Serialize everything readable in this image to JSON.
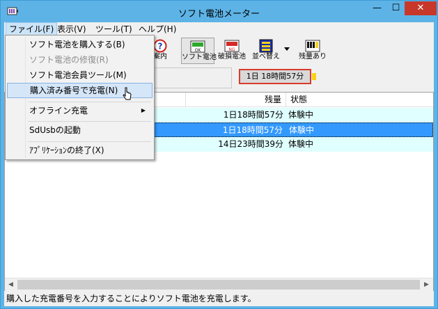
{
  "window": {
    "title": "ソフト電池メーター",
    "minimize": "—",
    "maximize": "☐",
    "close": "✕"
  },
  "menubar": [
    {
      "label": "ファイル(F)"
    },
    {
      "label": "表示(V)"
    },
    {
      "label": "ツール(T)"
    },
    {
      "label": "ヘルプ(H)"
    }
  ],
  "toolbar": {
    "guide": {
      "label": "案内",
      "icon": "question-icon"
    },
    "soft_battery": {
      "label": "ソフト電池",
      "icon_text": "OK"
    },
    "broken_battery": {
      "label": "破損電池",
      "icon_text": "NG"
    },
    "sort": {
      "label": "並べ替え"
    },
    "remaining": {
      "label": "残量あり"
    }
  },
  "battery_display": "1日 18時間57分",
  "list": {
    "columns": [
      "残量",
      "状態"
    ],
    "rows": [
      {
        "remaining": "1日18時間57分",
        "status": "体験中"
      },
      {
        "remaining": "1日18時間57分",
        "status": "体験中"
      },
      {
        "remaining": "14日23時間39分",
        "status": "体験中"
      }
    ]
  },
  "file_menu": {
    "items": [
      {
        "label": "ソフト電池を購入する(B)",
        "disabled": false
      },
      {
        "label": "ソフト電池の修復(R)",
        "disabled": true
      },
      {
        "label": "ソフト電池会員ツール(M)",
        "disabled": false
      },
      {
        "label": "購入済み番号で充電(N)",
        "disabled": false
      },
      {
        "label": "オフライン充電",
        "disabled": false
      },
      {
        "label": "SdUsbの起動",
        "disabled": false
      },
      {
        "label": "ｱﾌﾟﾘｹｰｼｮﾝの終了(X)",
        "disabled": false
      }
    ],
    "submenu_arrow": "▶"
  },
  "status_bar": "購入した充電番号を入力することによりソフト電池を充電します。",
  "colors": {
    "title_bar": "#5db3e6",
    "close_button": "#c7382b",
    "selection": "#3399ff",
    "alt_row": "#e0ffff",
    "battery_border": "#d93a2b",
    "battery_tip": "#f5d318"
  }
}
